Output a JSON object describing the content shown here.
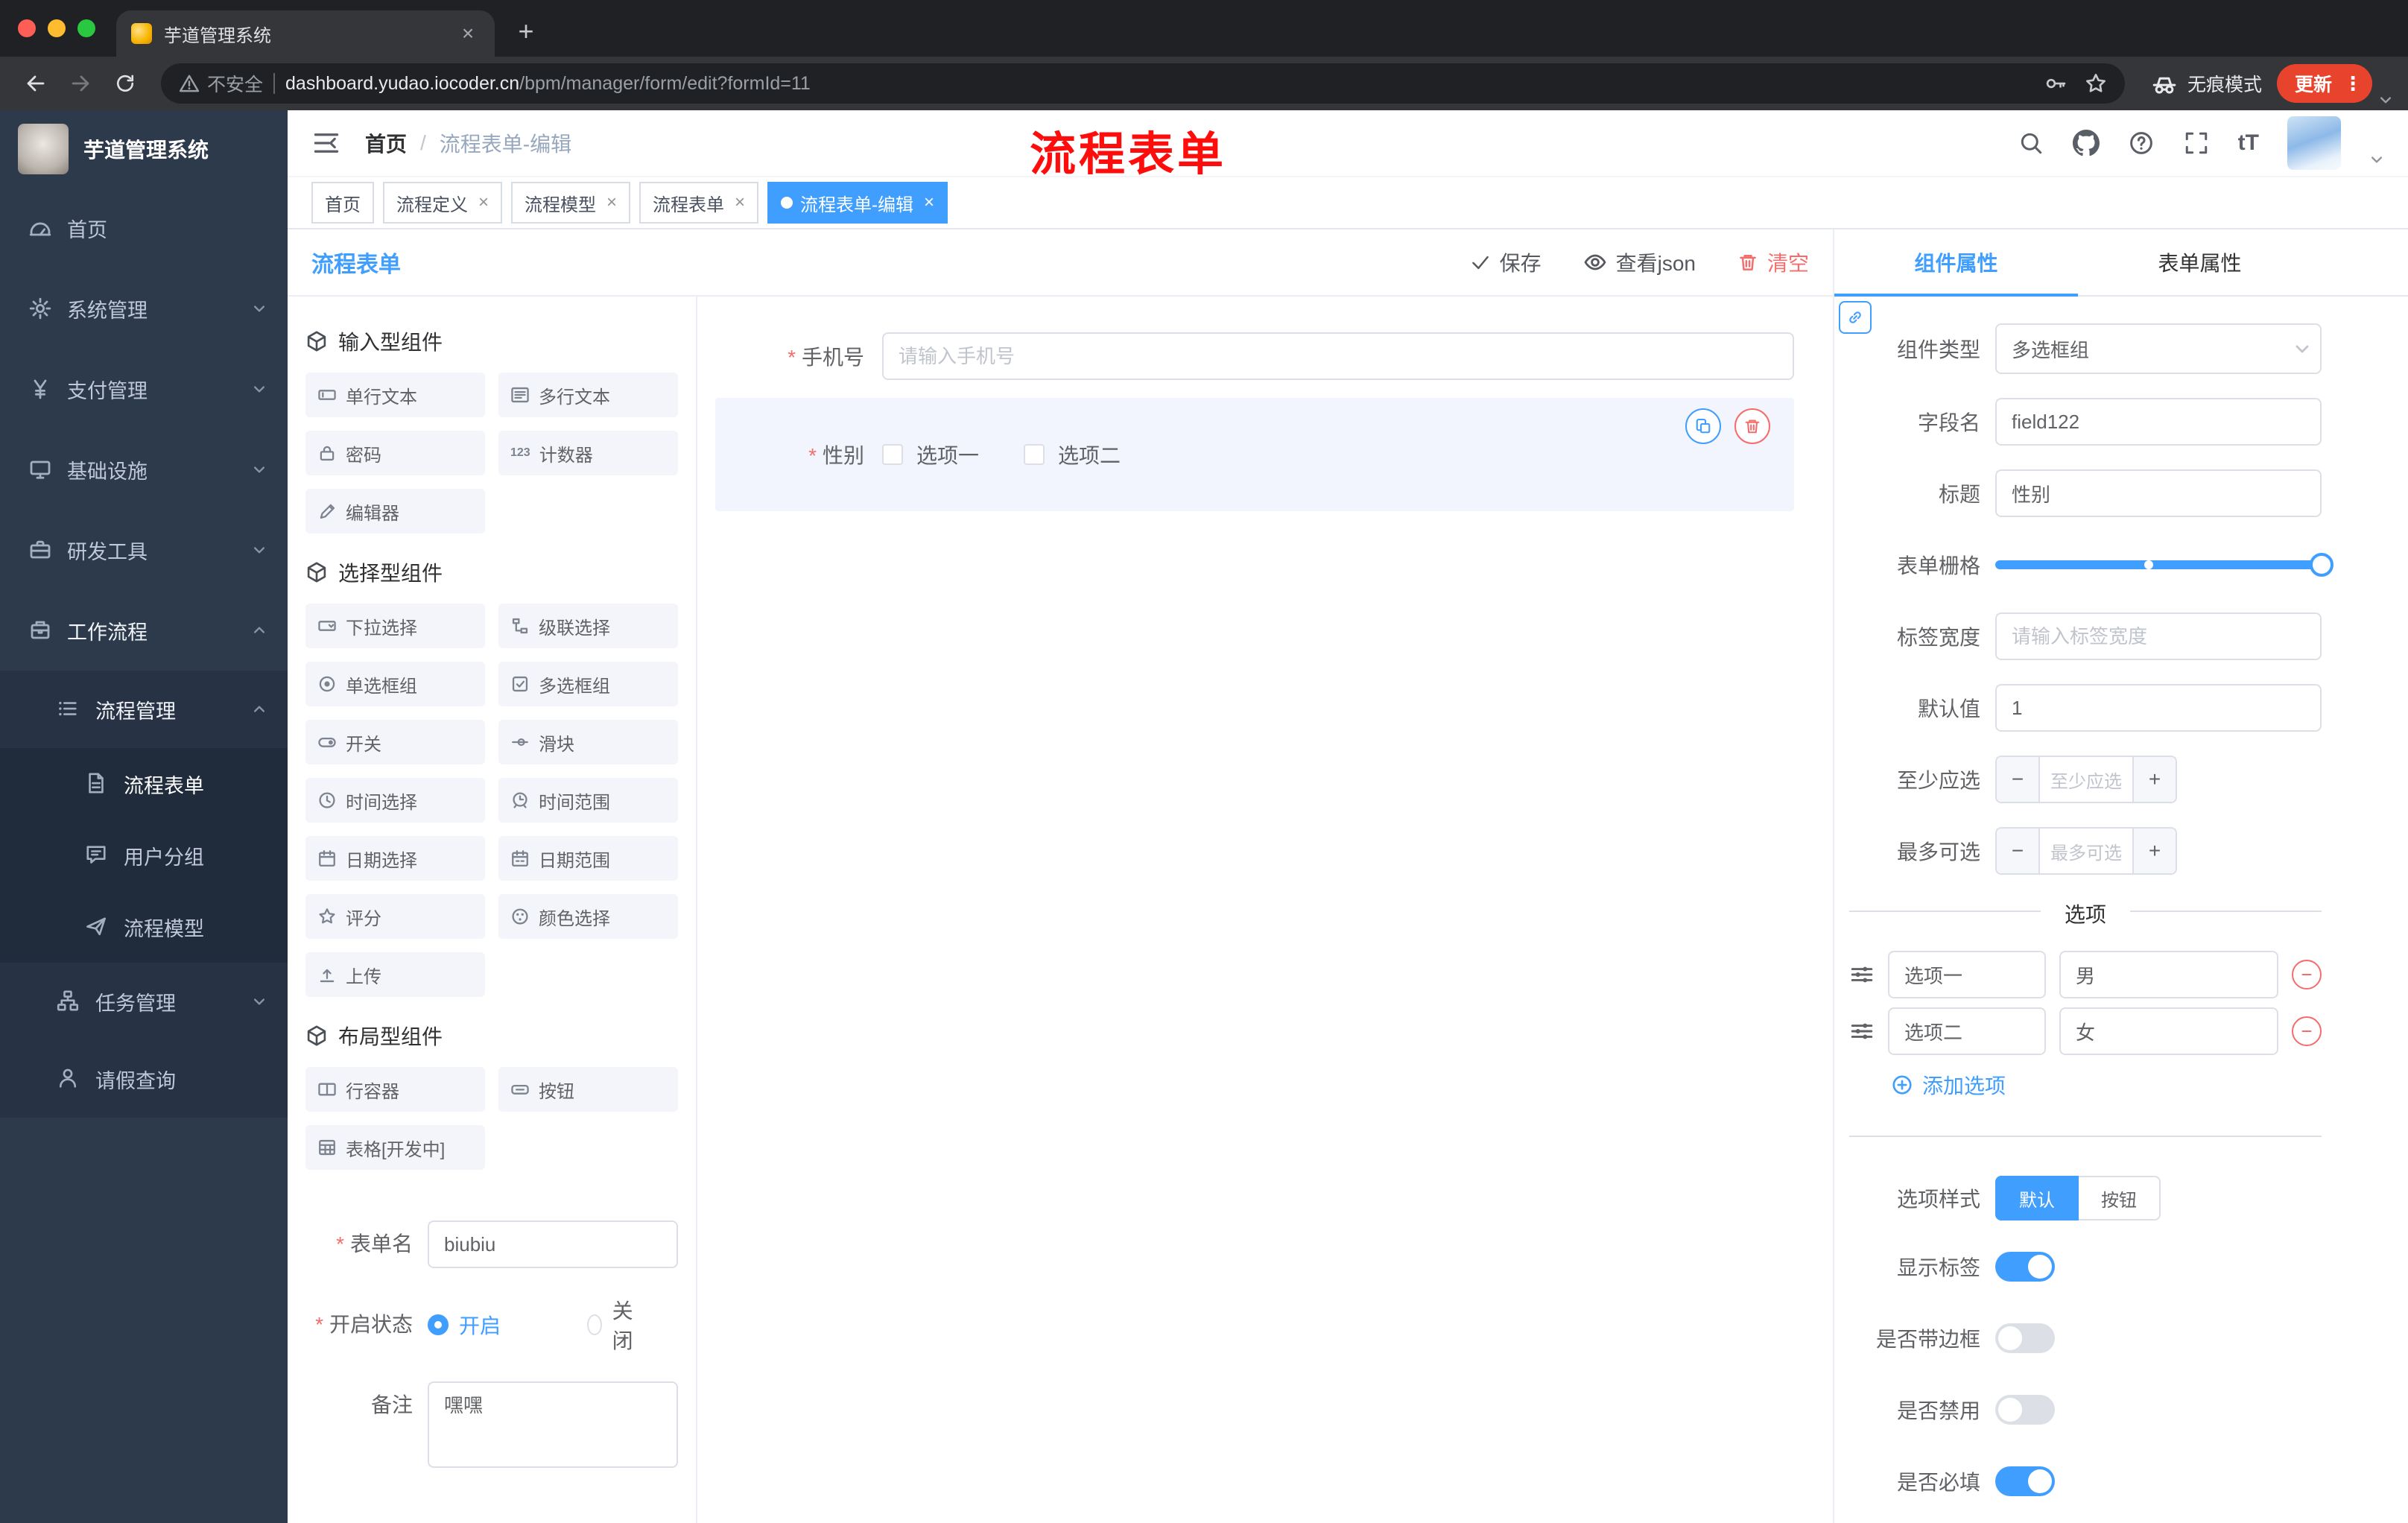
{
  "theme": {
    "accent": "#409eff",
    "danger": "#f56c6c",
    "annotation_red": "#fd0d0c",
    "sidebar_bg": "#2d3a4b",
    "update_pill": "#e8432c"
  },
  "icons": {
    "search": "magnifier",
    "github": "octocat-mark",
    "help": "question-circle",
    "fullscreen": "corner-brackets",
    "font_size": "tT",
    "save": "check",
    "view": "eye",
    "clear": "trash",
    "copy": "copy-sheets",
    "delete": "trash",
    "link": "chain",
    "add": "plus-circle",
    "remove": "minus-circle",
    "drag": "sliders",
    "incognito": "hat-glasses",
    "menu": "kebab-dots"
  },
  "browser": {
    "tab_title": "芋道管理系统",
    "security_label": "不安全",
    "url_host": "dashboard.yudao.iocoder.cn",
    "url_path": "/bpm/manager/form/edit?formId=11",
    "incognito_label": "无痕模式",
    "update_label": "更新"
  },
  "sidebar": {
    "app_title": "芋道管理系统",
    "items": [
      {
        "label": "首页"
      },
      {
        "label": "系统管理"
      },
      {
        "label": "支付管理"
      },
      {
        "label": "基础设施"
      },
      {
        "label": "研发工具"
      },
      {
        "label": "工作流程"
      }
    ],
    "process_mgmt": "流程管理",
    "process_children": [
      {
        "label": "流程表单"
      },
      {
        "label": "用户分组"
      },
      {
        "label": "流程模型"
      }
    ],
    "task_mgmt": "任务管理",
    "leave_query": "请假查询"
  },
  "header": {
    "breadcrumb_home": "首页",
    "breadcrumb_current": "流程表单-编辑",
    "annotation": "流程表单",
    "font_size_icon": "tT"
  },
  "tags": [
    {
      "label": "首页"
    },
    {
      "label": "流程定义"
    },
    {
      "label": "流程模型"
    },
    {
      "label": "流程表单"
    },
    {
      "label": "流程表单-编辑"
    }
  ],
  "designer": {
    "panel_title": "流程表单",
    "toolbar": {
      "save": "保存",
      "view_json": "查看json",
      "clear": "清空"
    },
    "palette": {
      "groups": [
        {
          "title": "输入型组件",
          "items": [
            {
              "label": "单行文本"
            },
            {
              "label": "多行文本"
            },
            {
              "label": "密码"
            },
            {
              "label": "计数器"
            },
            {
              "label": "编辑器"
            }
          ]
        },
        {
          "title": "选择型组件",
          "items": [
            {
              "label": "下拉选择"
            },
            {
              "label": "级联选择"
            },
            {
              "label": "单选框组"
            },
            {
              "label": "多选框组"
            },
            {
              "label": "开关"
            },
            {
              "label": "滑块"
            },
            {
              "label": "时间选择"
            },
            {
              "label": "时间范围"
            },
            {
              "label": "日期选择"
            },
            {
              "label": "日期范围"
            },
            {
              "label": "评分"
            },
            {
              "label": "颜色选择"
            },
            {
              "label": "上传"
            }
          ]
        },
        {
          "title": "布局型组件",
          "items": [
            {
              "label": "行容器"
            },
            {
              "label": "按钮"
            },
            {
              "label": "表格[开发中]"
            }
          ]
        }
      ]
    },
    "meta": {
      "name_label": "表单名",
      "name_value": "biubiu",
      "status_label": "开启状态",
      "status_on": "开启",
      "status_off": "关闭",
      "remark_label": "备注",
      "remark_value": "嘿嘿"
    },
    "canvas": {
      "phone_label": "手机号",
      "phone_placeholder": "请输入手机号",
      "gender_label": "性别",
      "gender_option1": "选项一",
      "gender_option2": "选项二"
    }
  },
  "props": {
    "tab_component": "组件属性",
    "tab_form": "表单属性",
    "type_label": "组件类型",
    "type_value": "多选框组",
    "field_label": "字段名",
    "field_value": "field122",
    "title_label": "标题",
    "title_value": "性别",
    "grid_label": "表单栅格",
    "label_width_label": "标签宽度",
    "label_width_placeholder": "请输入标签宽度",
    "default_label": "默认值",
    "default_value": "1",
    "min_label": "至少应选",
    "min_placeholder": "至少应选",
    "max_label": "最多可选",
    "max_placeholder": "最多可选",
    "options_title": "选项",
    "options": [
      {
        "name": "选项一",
        "value": "男"
      },
      {
        "name": "选项二",
        "value": "女"
      }
    ],
    "add_option": "添加选项",
    "style_label": "选项样式",
    "style_default": "默认",
    "style_button": "按钮",
    "show_label_label": "显示标签",
    "border_label": "是否带边框",
    "disabled_label": "是否禁用",
    "required_label": "是否必填"
  }
}
